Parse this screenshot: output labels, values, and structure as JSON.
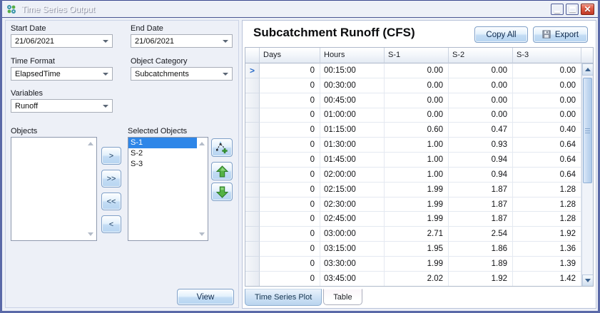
{
  "window": {
    "title": "Time Series Output",
    "controls": {
      "minimize": "minimize",
      "maximize": "maximize",
      "close": "close"
    }
  },
  "left_panel": {
    "fields": [
      {
        "label": "Start Date",
        "value": "21/06/2021"
      },
      {
        "label": "End Date",
        "value": "21/06/2021"
      },
      {
        "label": "Time Format",
        "value": "ElapsedTime"
      },
      {
        "label": "Object Category",
        "value": "Subcatchments"
      },
      {
        "label": "Variables",
        "value": "Runoff"
      }
    ],
    "objects_label": "Objects",
    "selected_objects_label": "Selected Objects",
    "objects": [],
    "selected_objects": [
      "S-1",
      "S-2",
      "S-3"
    ],
    "selected_index": 0,
    "transfer_buttons": [
      ">",
      ">>",
      "<<",
      "<"
    ],
    "view_button": "View"
  },
  "right_panel": {
    "title": "Subcatchment Runoff (CFS)",
    "copy_all_button": "Copy All",
    "export_button": "Export",
    "table": {
      "columns": [
        "Days",
        "Hours",
        "S-1",
        "S-2",
        "S-3"
      ],
      "current_row_index": 0,
      "rows": [
        [
          "0",
          "00:15:00",
          "0.00",
          "0.00",
          "0.00"
        ],
        [
          "0",
          "00:30:00",
          "0.00",
          "0.00",
          "0.00"
        ],
        [
          "0",
          "00:45:00",
          "0.00",
          "0.00",
          "0.00"
        ],
        [
          "0",
          "01:00:00",
          "0.00",
          "0.00",
          "0.00"
        ],
        [
          "0",
          "01:15:00",
          "0.60",
          "0.47",
          "0.40"
        ],
        [
          "0",
          "01:30:00",
          "1.00",
          "0.93",
          "0.64"
        ],
        [
          "0",
          "01:45:00",
          "1.00",
          "0.94",
          "0.64"
        ],
        [
          "0",
          "02:00:00",
          "1.00",
          "0.94",
          "0.64"
        ],
        [
          "0",
          "02:15:00",
          "1.99",
          "1.87",
          "1.28"
        ],
        [
          "0",
          "02:30:00",
          "1.99",
          "1.87",
          "1.28"
        ],
        [
          "0",
          "02:45:00",
          "1.99",
          "1.87",
          "1.28"
        ],
        [
          "0",
          "03:00:00",
          "2.71",
          "2.54",
          "1.92"
        ],
        [
          "0",
          "03:15:00",
          "1.95",
          "1.86",
          "1.36"
        ],
        [
          "0",
          "03:30:00",
          "1.99",
          "1.89",
          "1.39"
        ],
        [
          "0",
          "03:45:00",
          "2.02",
          "1.92",
          "1.42"
        ]
      ]
    },
    "tabs": [
      {
        "label": "Time Series Plot",
        "active": false
      },
      {
        "label": "Table",
        "active": true
      }
    ]
  },
  "icons": {
    "app": "app-logo-icon",
    "combo": "chevron-down-icon",
    "select_from_map": "select-from-map-plus-icon",
    "move_up": "green-up-arrow-icon",
    "move_down": "green-down-arrow-icon",
    "export": "save-disk-icon",
    "current_row": "current-row-arrow-icon"
  },
  "colors": {
    "titlebar_top": "#98A2CD",
    "titlebar_bottom": "#6B79B1",
    "selection_blue": "#2E86E8",
    "close_button_red": "#C23A26",
    "green_arrow": "#54B244",
    "panel_bg": "#EDF0F7",
    "grid_line": "#E4E9F1"
  }
}
